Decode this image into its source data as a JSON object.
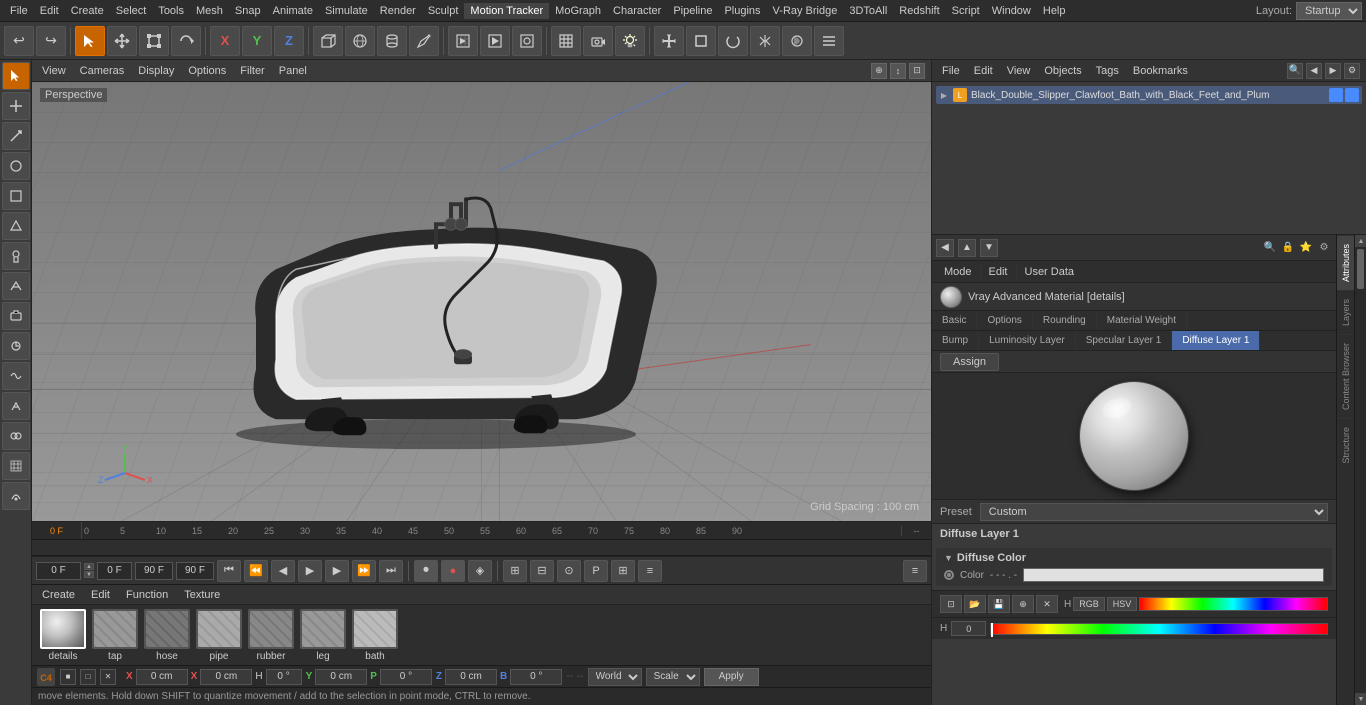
{
  "menubar": {
    "items": [
      "File",
      "Edit",
      "Create",
      "Select",
      "Tools",
      "Mesh",
      "Snap",
      "Animate",
      "Simulate",
      "Render",
      "Sculpt",
      "Motion Tracker",
      "MoGraph",
      "Character",
      "Pipeline",
      "Plugins",
      "V-Ray Bridge",
      "3DToAll",
      "Redshift",
      "Script",
      "Window",
      "Help"
    ],
    "layout_label": "Layout:",
    "layout_value": "Startup"
  },
  "toolbar": {
    "undo_label": "↩",
    "redo_label": "↪",
    "axis_x": "X",
    "axis_y": "Y",
    "axis_z": "Z",
    "mode_label": "Mode"
  },
  "viewport": {
    "menus": [
      "View",
      "Cameras",
      "Display",
      "Options",
      "Filter",
      "Panel"
    ],
    "perspective_label": "Perspective",
    "grid_spacing": "Grid Spacing : 100 cm"
  },
  "timeline": {
    "frame_current": "0 F",
    "frame_end_1": "90 F",
    "frame_end_2": "90 F",
    "frame_start": "0 F",
    "ruler_marks": [
      "0",
      "5",
      "10",
      "15",
      "20",
      "25",
      "30",
      "35",
      "40",
      "45",
      "50",
      "55",
      "60",
      "65",
      "70",
      "75",
      "80",
      "85",
      "90"
    ],
    "frame_indicator": "0 F"
  },
  "bottom_bar": {
    "menu_items": [
      "Create",
      "Edit",
      "Function",
      "Texture"
    ],
    "materials": [
      {
        "label": "details",
        "selected": true
      },
      {
        "label": "tap",
        "selected": false
      },
      {
        "label": "hose",
        "selected": false
      },
      {
        "label": "pipe",
        "selected": false
      },
      {
        "label": "rubber",
        "selected": false
      },
      {
        "label": "leg",
        "selected": false
      },
      {
        "label": "bath",
        "selected": false
      }
    ]
  },
  "status_bar": {
    "text": "move elements. Hold down SHIFT to quantize movement / add to the selection in point mode, CTRL to remove."
  },
  "object_manager": {
    "menus": [
      "File",
      "Edit",
      "View",
      "Objects",
      "Tags",
      "Bookmarks"
    ],
    "search_placeholder": "🔍",
    "object_name": "Black_Double_Slipper_Clawfoot_Bath_with_Black_Feet_and_Plum"
  },
  "right_tabs": {
    "tabs": [
      "Attributes",
      "Layers",
      "Content Browser",
      "Structure"
    ]
  },
  "material_editor": {
    "title": "Vray Advanced Material [details]",
    "tabs_row1": [
      "Basic",
      "Options",
      "Rounding",
      "Material Weight"
    ],
    "tabs_row2": [
      "Bump",
      "Luminosity Layer",
      "Specular Layer 1",
      "Diffuse Layer 1"
    ],
    "assign_label": "Assign",
    "preset_label": "Preset",
    "preset_value": "Custom",
    "diffuse_layer_title": "Diffuse Layer 1",
    "diffuse_color_title": "Diffuse Color",
    "color_label": "Color",
    "color_dots": "- - - . -",
    "color_btn_labels": [
      "RGB",
      "HSV"
    ]
  },
  "coords": {
    "x_label": "X",
    "y_label": "Y",
    "z_label": "Z",
    "x_val1": "0 cm",
    "y_val1": "0 cm",
    "z_val1": "0 cm",
    "x_val2": "0 cm",
    "y_val2": "0 cm",
    "z_val2": "0 cm",
    "h_label": "H",
    "p_label": "P",
    "b_label": "B",
    "h_val": "0 °",
    "p_val": "0 °",
    "b_val": "0 °",
    "world_label": "World",
    "scale_label": "Scale",
    "apply_label": "Apply"
  },
  "colors": {
    "accent_orange": "#c86400",
    "accent_blue": "#4a6aaa",
    "active_tab": "#4a6aaa",
    "bg_dark": "#2a2a2a",
    "bg_mid": "#3a3a3a",
    "toolbar_bg": "#3a3a3a"
  }
}
